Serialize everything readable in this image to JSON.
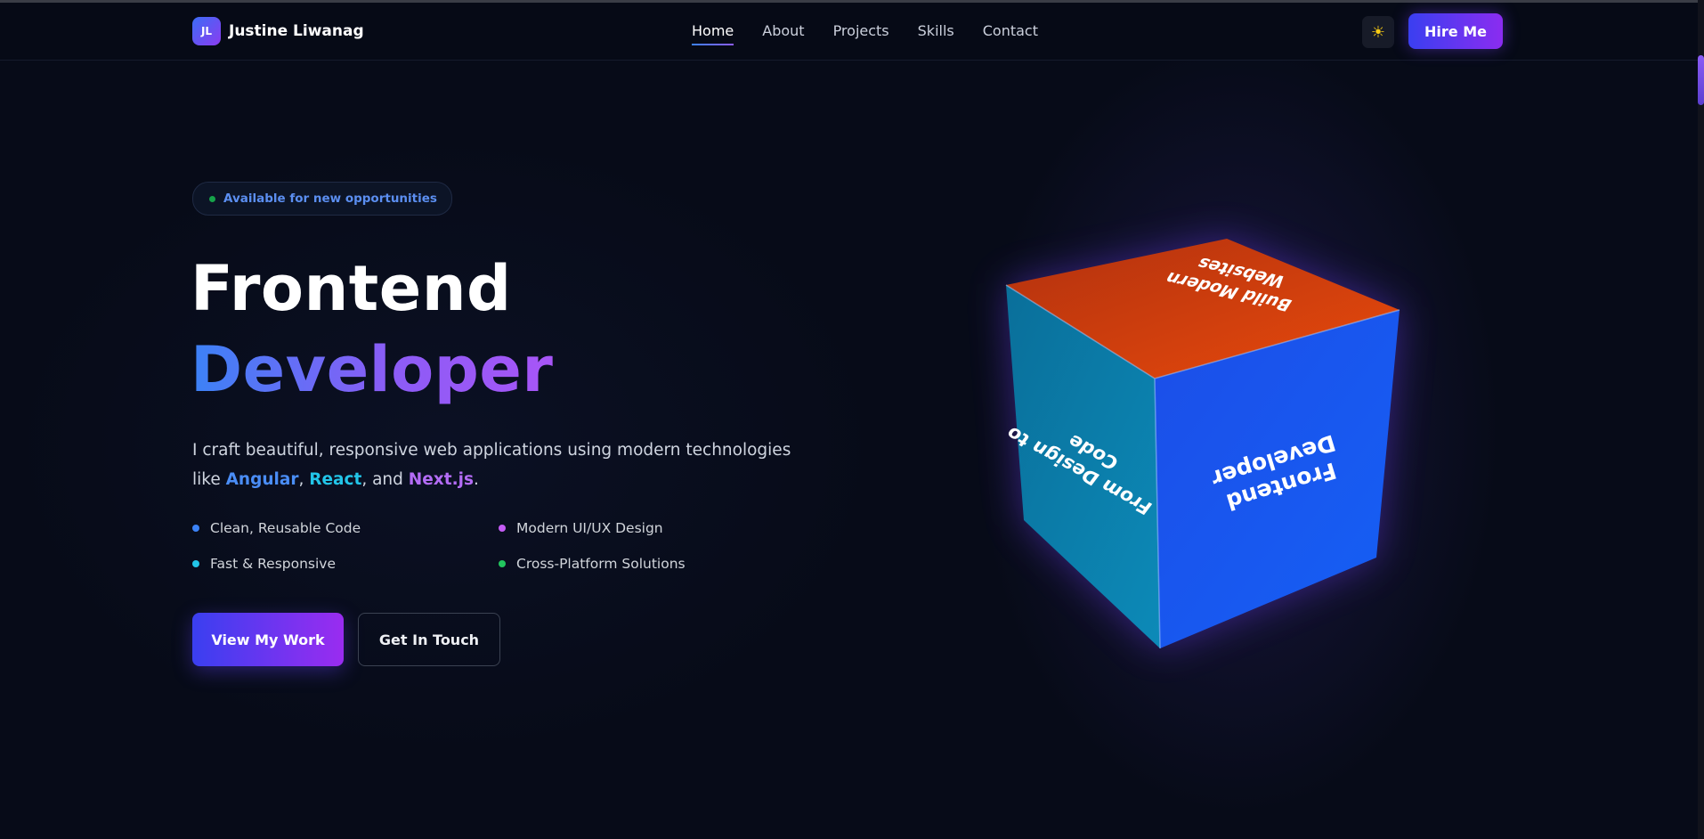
{
  "nav": {
    "brand_initials": "JL",
    "brand_name": "Justine Liwanag",
    "links": [
      "Home",
      "About",
      "Projects",
      "Skills",
      "Contact"
    ],
    "active_link": "Home",
    "theme_icon": "sun-icon",
    "theme_glyph": "☀",
    "hire_label": "Hire Me"
  },
  "hero": {
    "badge": "Available for new opportunities",
    "title_line1": "Frontend",
    "title_line2": "Developer",
    "desc_prefix": "I craft beautiful, responsive web applications using modern technologies like ",
    "tech": [
      "Angular",
      "React",
      "Next.js"
    ],
    "desc_sep1": ", ",
    "desc_sep2": ", and ",
    "desc_suffix": ".",
    "features": [
      {
        "label": "Clean, Reusable Code",
        "color": "#3b82f6"
      },
      {
        "label": "Modern UI/UX Design",
        "color": "#c55cf5"
      },
      {
        "label": "Fast & Responsive",
        "color": "#22c5e8"
      },
      {
        "label": "Cross-Platform Solutions",
        "color": "#22c55e"
      }
    ],
    "primary_button": "View My Work",
    "secondary_button": "Get In Touch"
  },
  "cube": {
    "top_face": [
      "Build Modern",
      "Websites"
    ],
    "left_face": [
      "From Design to",
      "Code"
    ],
    "right_face": [
      "Frontend",
      "Developer"
    ],
    "colors": {
      "top": "#e04a10",
      "left": "#0b7ea8",
      "right": "#1a55f0"
    }
  },
  "colors": {
    "background": "#070b18",
    "accent_blue": "#3b82f6",
    "accent_purple": "#8b5cf6"
  }
}
